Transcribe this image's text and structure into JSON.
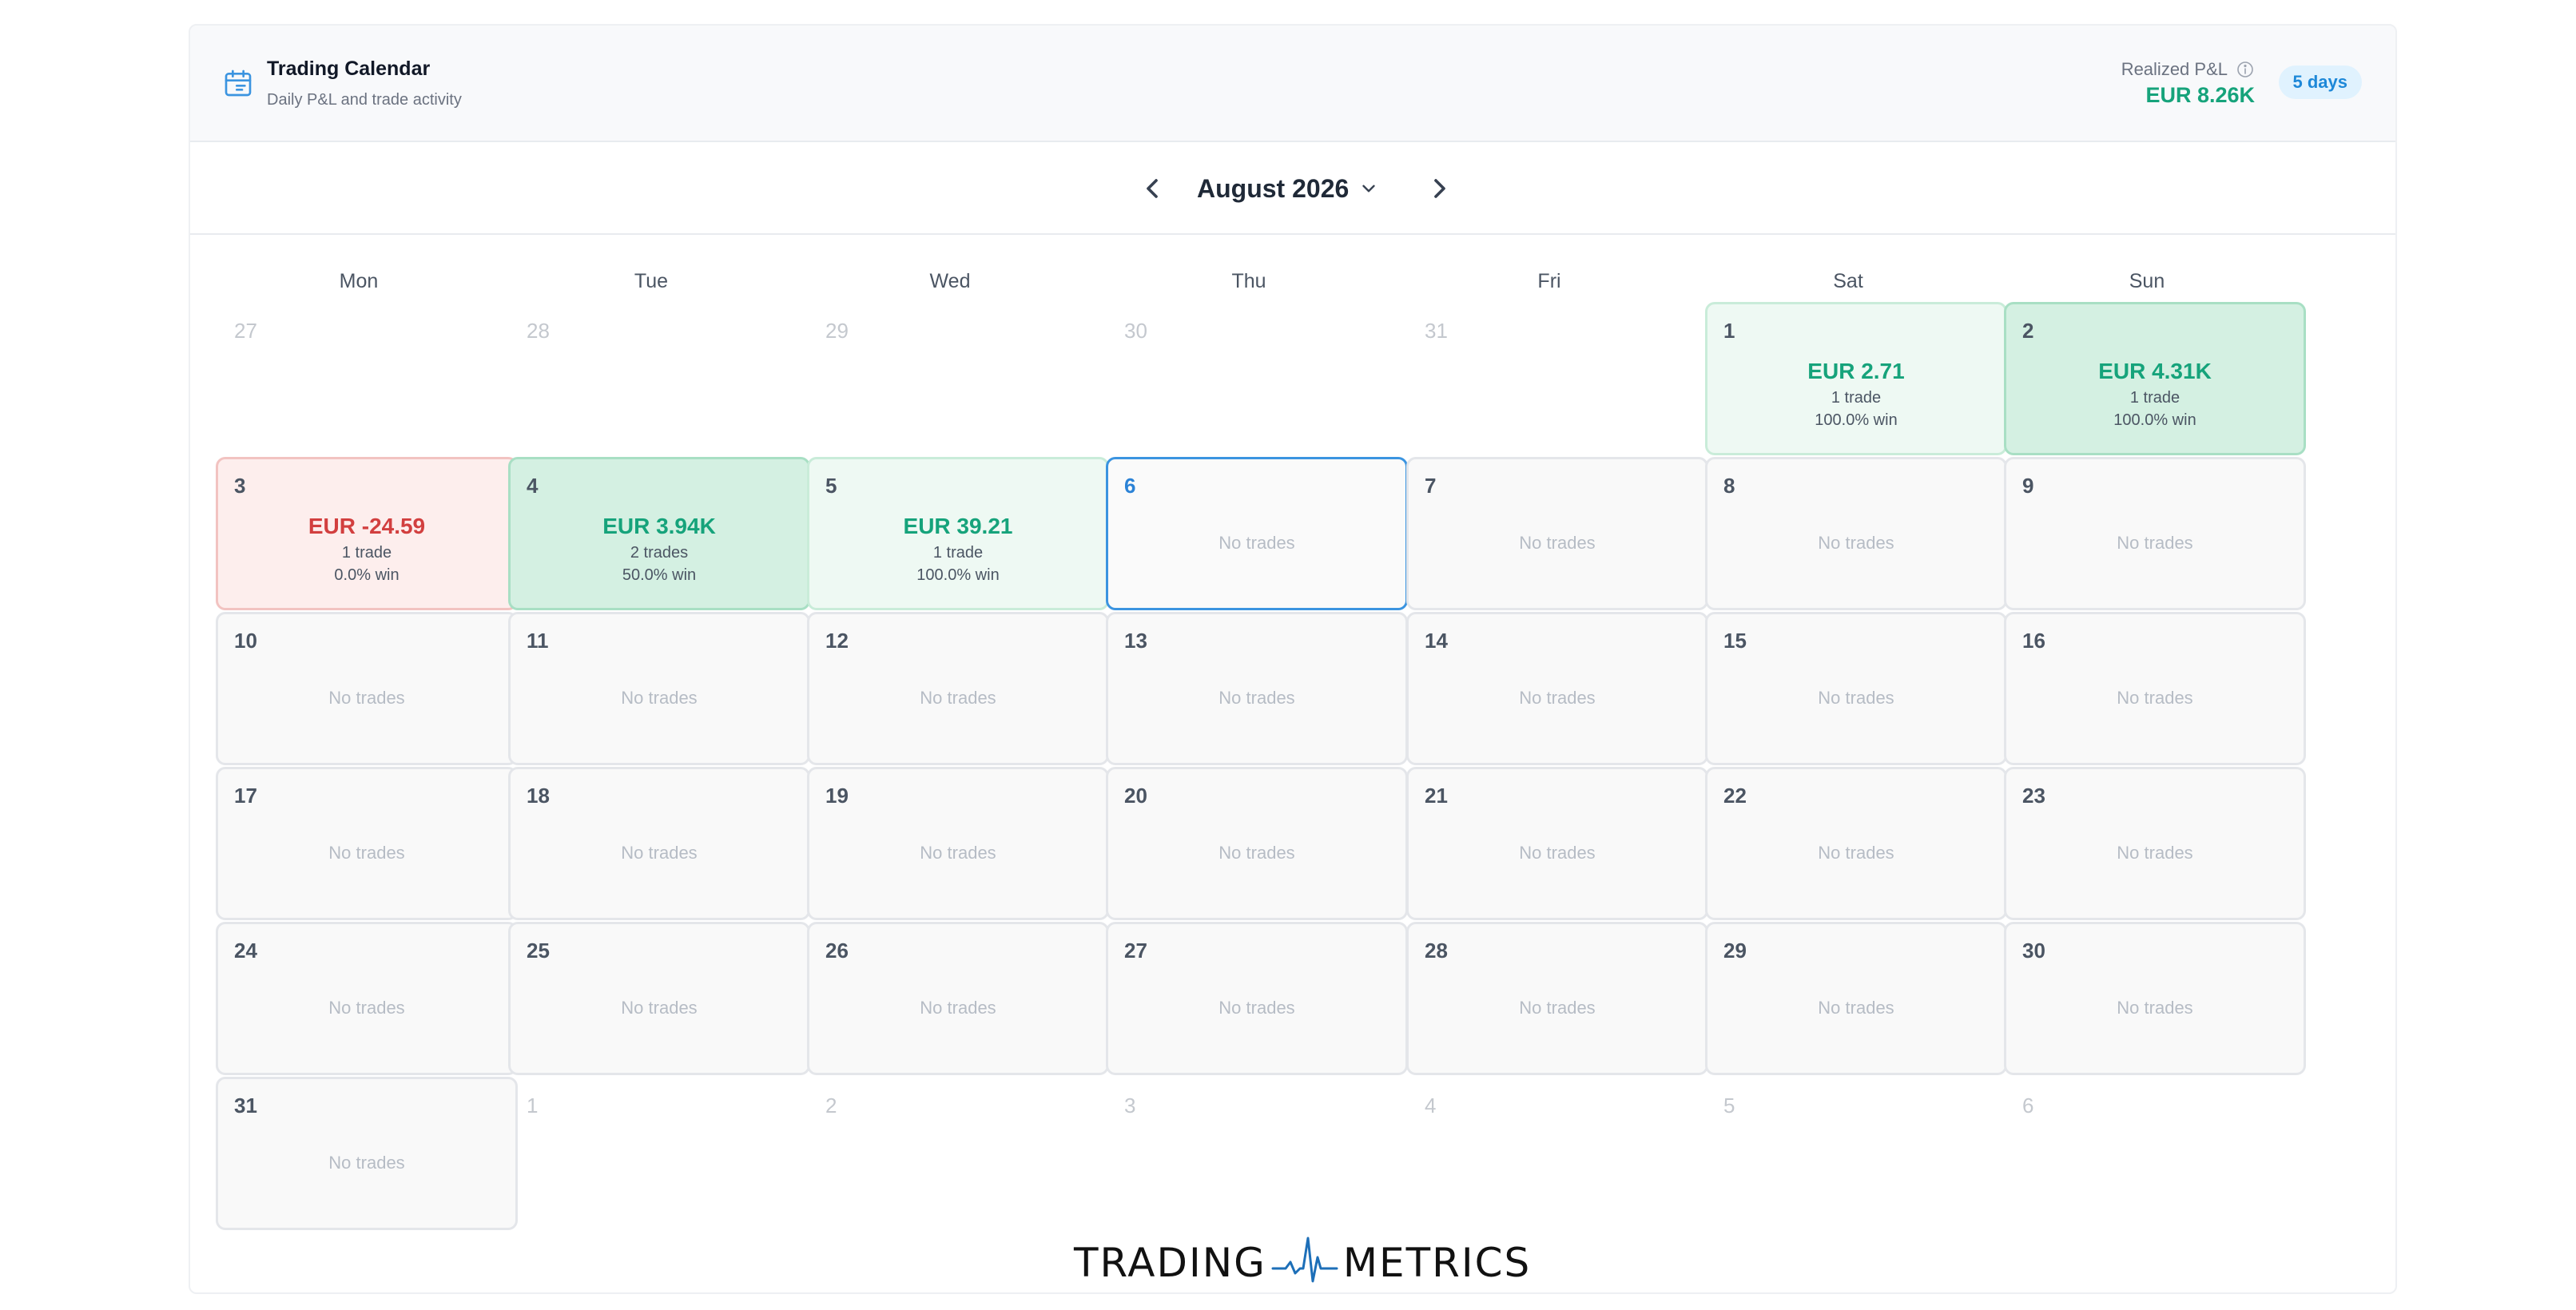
{
  "header": {
    "title": "Trading Calendar",
    "subtitle": "Daily P&L and trade activity",
    "pnl_label": "Realized P&L",
    "pnl_value": "EUR 8.26K",
    "days_badge": "5 days"
  },
  "nav": {
    "month_label": "August 2026"
  },
  "weekdays": [
    "Mon",
    "Tue",
    "Wed",
    "Thu",
    "Fri",
    "Sat",
    "Sun"
  ],
  "weeks": [
    [
      {
        "day": "27",
        "state": "out"
      },
      {
        "day": "28",
        "state": "out"
      },
      {
        "day": "29",
        "state": "out"
      },
      {
        "day": "30",
        "state": "out"
      },
      {
        "day": "31",
        "state": "out"
      },
      {
        "day": "1",
        "state": "win",
        "pnl": "EUR 2.71",
        "trades": "1 trade",
        "win_rate": "100.0% win"
      },
      {
        "day": "2",
        "state": "bigwin",
        "pnl": "EUR 4.31K",
        "trades": "1 trade",
        "win_rate": "100.0% win"
      }
    ],
    [
      {
        "day": "3",
        "state": "loss",
        "pnl": "EUR -24.59",
        "trades": "1 trade",
        "win_rate": "0.0% win"
      },
      {
        "day": "4",
        "state": "bigwin",
        "pnl": "EUR 3.94K",
        "trades": "2 trades",
        "win_rate": "50.0% win"
      },
      {
        "day": "5",
        "state": "win",
        "pnl": "EUR 39.21",
        "trades": "1 trade",
        "win_rate": "100.0% win"
      },
      {
        "day": "6",
        "state": "today",
        "empty": "No trades"
      },
      {
        "day": "7",
        "state": "empty",
        "empty": "No trades"
      },
      {
        "day": "8",
        "state": "empty",
        "empty": "No trades"
      },
      {
        "day": "9",
        "state": "empty",
        "empty": "No trades"
      }
    ],
    [
      {
        "day": "10",
        "state": "empty",
        "empty": "No trades"
      },
      {
        "day": "11",
        "state": "empty",
        "empty": "No trades"
      },
      {
        "day": "12",
        "state": "empty",
        "empty": "No trades"
      },
      {
        "day": "13",
        "state": "empty",
        "empty": "No trades"
      },
      {
        "day": "14",
        "state": "empty",
        "empty": "No trades"
      },
      {
        "day": "15",
        "state": "empty",
        "empty": "No trades"
      },
      {
        "day": "16",
        "state": "empty",
        "empty": "No trades"
      }
    ],
    [
      {
        "day": "17",
        "state": "empty",
        "empty": "No trades"
      },
      {
        "day": "18",
        "state": "empty",
        "empty": "No trades"
      },
      {
        "day": "19",
        "state": "empty",
        "empty": "No trades"
      },
      {
        "day": "20",
        "state": "empty",
        "empty": "No trades"
      },
      {
        "day": "21",
        "state": "empty",
        "empty": "No trades"
      },
      {
        "day": "22",
        "state": "empty",
        "empty": "No trades"
      },
      {
        "day": "23",
        "state": "empty",
        "empty": "No trades"
      }
    ],
    [
      {
        "day": "24",
        "state": "empty",
        "empty": "No trades"
      },
      {
        "day": "25",
        "state": "empty",
        "empty": "No trades"
      },
      {
        "day": "26",
        "state": "empty",
        "empty": "No trades"
      },
      {
        "day": "27",
        "state": "empty",
        "empty": "No trades"
      },
      {
        "day": "28",
        "state": "empty",
        "empty": "No trades"
      },
      {
        "day": "29",
        "state": "empty",
        "empty": "No trades"
      },
      {
        "day": "30",
        "state": "empty",
        "empty": "No trades"
      }
    ],
    [
      {
        "day": "31",
        "state": "empty",
        "empty": "No trades"
      },
      {
        "day": "1",
        "state": "out"
      },
      {
        "day": "2",
        "state": "out"
      },
      {
        "day": "3",
        "state": "out"
      },
      {
        "day": "4",
        "state": "out"
      },
      {
        "day": "5",
        "state": "out"
      },
      {
        "day": "6",
        "state": "out"
      }
    ]
  ],
  "brand": {
    "left": "TRADING",
    "right": "METRICS"
  },
  "colors": {
    "profit": "#16a37b",
    "loss": "#d23f3f",
    "today_border": "#3b94e0",
    "badge_text": "#1e88d8"
  }
}
